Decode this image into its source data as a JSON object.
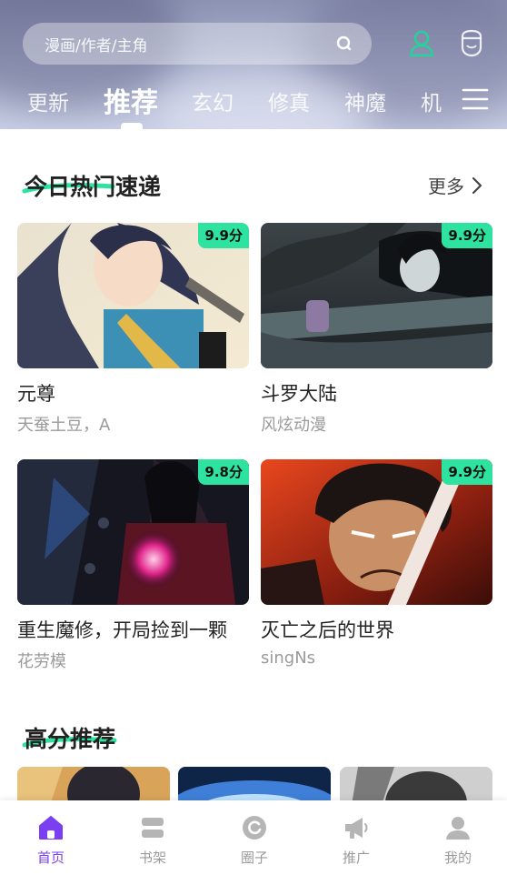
{
  "header": {
    "search_placeholder": "漫画/作者/主角",
    "icons": [
      "search-icon",
      "user-icon",
      "face-icon",
      "menu-icon"
    ],
    "tabs": [
      {
        "label": "更新",
        "active": false
      },
      {
        "label": "推荐",
        "active": true
      },
      {
        "label": "玄幻",
        "active": false
      },
      {
        "label": "修真",
        "active": false
      },
      {
        "label": "神魔",
        "active": false
      },
      {
        "label": "机",
        "active": false
      }
    ]
  },
  "hot_section": {
    "title": "今日热门速递",
    "more_label": "更多",
    "items": [
      {
        "title": "元尊",
        "author": "天蚕土豆，A",
        "score": "9.9分"
      },
      {
        "title": "斗罗大陆",
        "author": "风炫动漫",
        "score": "9.9分"
      },
      {
        "title": "重生魔修，开局捡到一颗",
        "author": "花劳模",
        "score": "9.8分"
      },
      {
        "title": "灭亡之后的世界",
        "author": "singNs",
        "score": "9.9分"
      }
    ]
  },
  "high_score_section": {
    "title": "高分推荐"
  },
  "bottom_nav": {
    "items": [
      {
        "label": "首页",
        "icon": "home-icon",
        "active": true
      },
      {
        "label": "书架",
        "icon": "bookshelf-icon",
        "active": false
      },
      {
        "label": "圈子",
        "icon": "circle-icon",
        "active": false
      },
      {
        "label": "推广",
        "icon": "megaphone-icon",
        "active": false
      },
      {
        "label": "我的",
        "icon": "profile-icon",
        "active": false
      }
    ]
  },
  "colors": {
    "accent": "#7b3ff2",
    "score_badge": "#2ee39f",
    "underline": "#2ee39f",
    "user_icon": "#25d39a"
  }
}
